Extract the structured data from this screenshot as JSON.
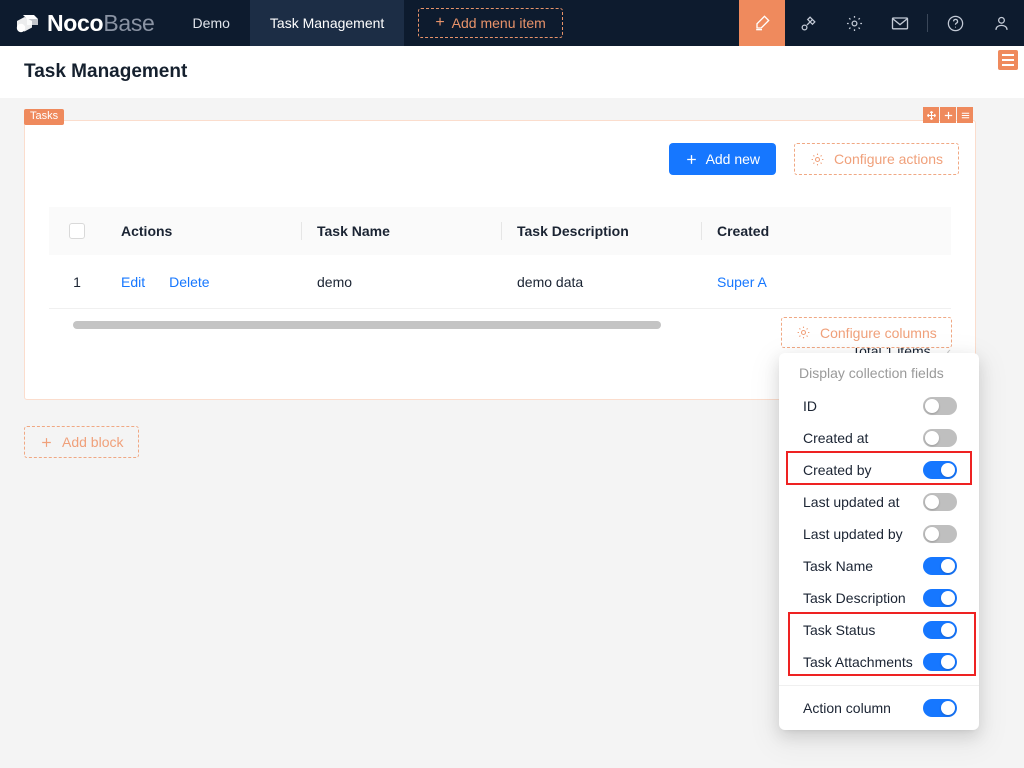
{
  "app": {
    "brand_primary": "Noco",
    "brand_secondary": "Base",
    "logo_icon": "cube-logo-icon",
    "accent_orange": "#ef8a5d",
    "accent_blue": "#1677ff",
    "header_bg": "#0d1b2e",
    "annotation_red": "#ee2222"
  },
  "topnav": {
    "items": [
      {
        "label": "Demo",
        "active": false
      },
      {
        "label": "Task Management",
        "active": true
      }
    ],
    "add_menu_item": {
      "plus": "+",
      "label": "Add menu item"
    },
    "icons": [
      {
        "name": "highlighter-icon",
        "glyph": "highlighter",
        "active": true
      },
      {
        "name": "plugin-icon",
        "glyph": "plugin",
        "active": false
      },
      {
        "name": "gear-icon",
        "glyph": "gear",
        "active": false
      },
      {
        "name": "mail-icon",
        "glyph": "mail",
        "active": false
      },
      {
        "name": "help-icon",
        "glyph": "question",
        "active": false
      },
      {
        "name": "user-avatar-icon",
        "glyph": "user",
        "active": false
      }
    ]
  },
  "page": {
    "title": "Task Management",
    "hamburger_icon": "menu-icon"
  },
  "block": {
    "tag": "Tasks",
    "handles": [
      {
        "name": "drag-move-handle",
        "glyph": "✥"
      },
      {
        "name": "add-block-handle",
        "glyph": "＋"
      },
      {
        "name": "block-menu-handle",
        "glyph": "≡"
      }
    ],
    "toolbar": {
      "add_new": {
        "plus": "+",
        "label": "Add new"
      },
      "configure_actions": {
        "icon": "gear-icon",
        "label": "Configure actions"
      }
    },
    "configure_columns": {
      "icon": "gear-icon",
      "label": "Configure columns"
    }
  },
  "table": {
    "columns": [
      {
        "key": "check",
        "label": ""
      },
      {
        "key": "actions",
        "label": "Actions"
      },
      {
        "key": "task_name",
        "label": "Task Name"
      },
      {
        "key": "task_description",
        "label": "Task Description"
      },
      {
        "key": "created_by",
        "label": "Created"
      }
    ],
    "rows": [
      {
        "index": "1",
        "edit": "Edit",
        "delete": "Delete",
        "task_name": "demo",
        "task_description": "demo data",
        "created_by": "Super A"
      }
    ],
    "pagination": {
      "total": "Total 1 items",
      "prev": "‹"
    }
  },
  "add_block": {
    "plus": "+",
    "label": "Add block"
  },
  "dropdown": {
    "title": "Display collection fields",
    "fields": [
      {
        "label": "ID",
        "enabled": false,
        "highlighted": false
      },
      {
        "label": "Created at",
        "enabled": false,
        "highlighted": false
      },
      {
        "label": "Created by",
        "enabled": true,
        "highlighted": true
      },
      {
        "label": "Last updated at",
        "enabled": false,
        "highlighted": false
      },
      {
        "label": "Last updated by",
        "enabled": false,
        "highlighted": false
      },
      {
        "label": "Task Name",
        "enabled": true,
        "highlighted": false
      },
      {
        "label": "Task Description",
        "enabled": true,
        "highlighted": false
      },
      {
        "label": "Task Status",
        "enabled": true,
        "highlighted": true
      },
      {
        "label": "Task Attachments",
        "enabled": true,
        "highlighted": true
      }
    ],
    "action_column": {
      "label": "Action column",
      "enabled": true
    }
  }
}
